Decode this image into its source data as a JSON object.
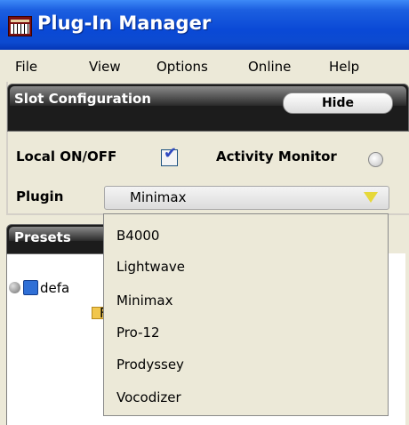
{
  "window": {
    "title": "Plug-In Manager"
  },
  "menu": [
    "File",
    "View",
    "Options",
    "Online",
    "Help"
  ],
  "slot_config": {
    "title": "Slot Configuration",
    "hide_label": "Hide",
    "local_label": "Local ON/OFF",
    "local_checked": true,
    "activity_label": "Activity Monitor",
    "plugin_label": "Plugin",
    "plugin_selected": "Minimax"
  },
  "dropdown": {
    "options": [
      "B4000",
      "Lightwave",
      "Minimax",
      "Pro-12",
      "Prodyssey",
      "Vocodizer"
    ]
  },
  "presets": {
    "title": "Presets",
    "item1": "defa",
    "item2": "F"
  }
}
